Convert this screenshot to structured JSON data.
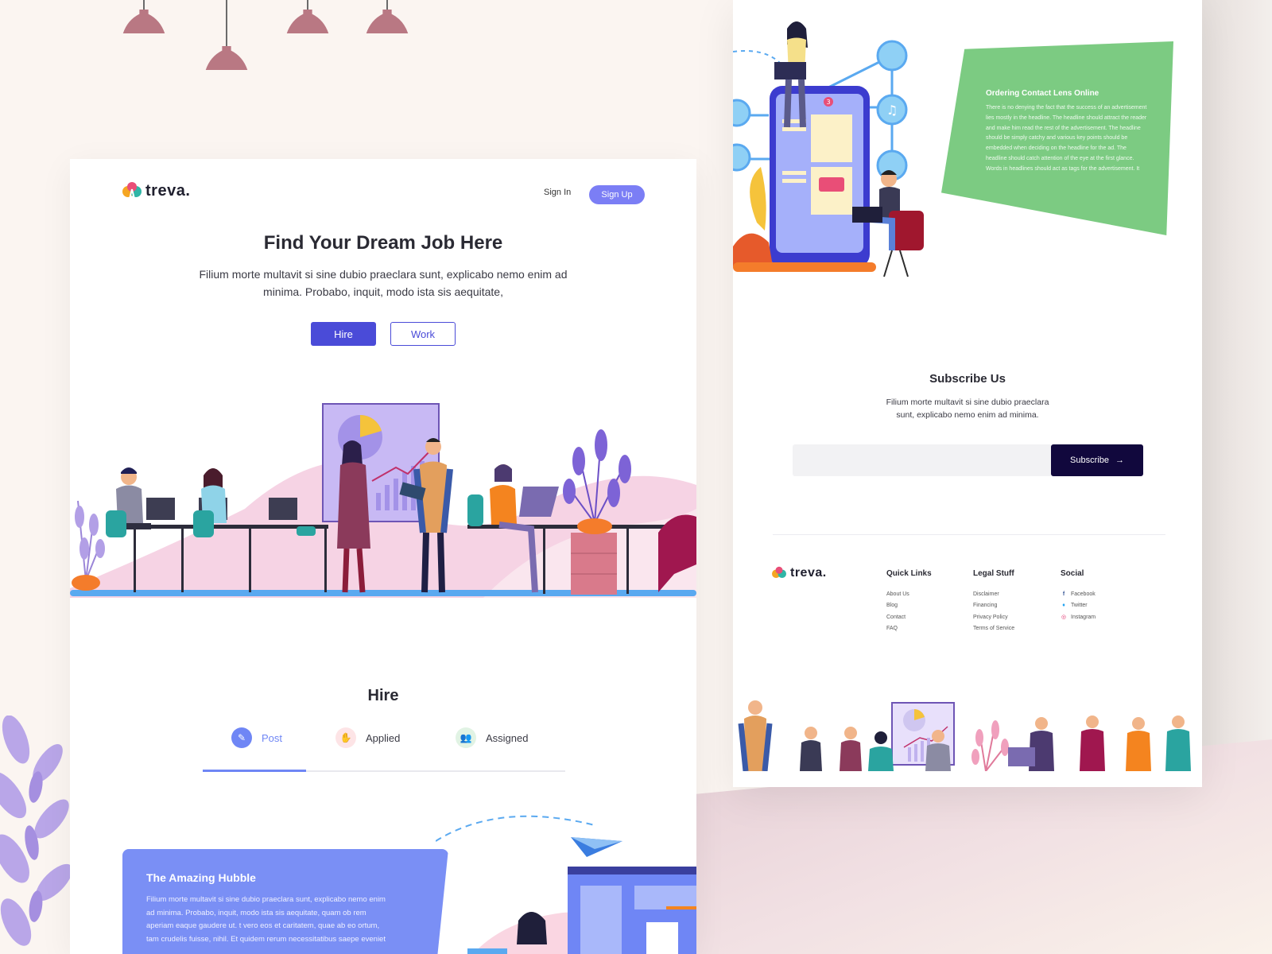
{
  "brand": {
    "name": "treva."
  },
  "nav": {
    "sign_in": "Sign In",
    "sign_up": "Sign Up"
  },
  "hero": {
    "title": "Find Your Dream Job Here",
    "description": "Filium morte multavit si sine dubio praeclara sunt, explicabo nemo enim ad minima. Probabo, inquit, modo ista sis aequitate,",
    "hire_button": "Hire",
    "work_button": "Work"
  },
  "hire_section": {
    "title": "Hire",
    "tabs": [
      {
        "label": "Post",
        "icon": "pencil-icon",
        "color": "#6f86f5",
        "active": true
      },
      {
        "label": "Applied",
        "icon": "handshake-icon",
        "color": "#f7a7ad",
        "active": false
      },
      {
        "label": "Assigned",
        "icon": "users-icon",
        "color": "#8fcf9a",
        "active": false
      }
    ]
  },
  "feature_card": {
    "title": "The Amazing Hubble",
    "description": "Filium morte multavit si sine dubio praeclara sunt, explicabo nemo enim ad minima. Probabo, inquit, modo ista sis aequitate, quam ob rem aperiam eaque gaudere ut. t vero eos et caritatem, quae ab eo ortum, tam crudelis fuisse, nihil. Et quidem rerum necessitatibus saepe eveniet"
  },
  "promo_card": {
    "title": "Ordering Contact Lens Online",
    "description": "There is no denying the fact that the success of an advertisement lies mostly in the headline. The headline should attract the reader and make him read the rest of the advertisement. The headline should be simply catchy and various key points should be embedded when deciding on the headline for the ad. The headline should catch attention of the eye at the first glance. Words in headlines should act as tags for the advertisement. It"
  },
  "phone_badge": "3",
  "subscribe": {
    "title": "Subscribe Us",
    "description": "Filium morte multavit si sine dubio praeclara sunt, explicabo nemo enim ad minima.",
    "input_placeholder": "",
    "button": "Subscribe"
  },
  "footer": {
    "quick_links": {
      "heading": "Quick Links",
      "items": [
        "About Us",
        "Blog",
        "Contact",
        "FAQ"
      ]
    },
    "legal": {
      "heading": "Legal Stuff",
      "items": [
        "Disclaimer",
        "Financing",
        "Privacy Policy",
        "Terms of Service"
      ]
    },
    "social": {
      "heading": "Social",
      "items": [
        {
          "label": "Facebook",
          "icon": "facebook-icon"
        },
        {
          "label": "Twitter",
          "icon": "twitter-icon"
        },
        {
          "label": "Instagram",
          "icon": "instagram-icon"
        }
      ]
    }
  },
  "colors": {
    "primary": "#4a4bd8",
    "signup": "#7b7ef5",
    "feature_card": "#7a8ff5",
    "promo_card": "#7ccb82",
    "subscribe_button": "#11083d"
  }
}
